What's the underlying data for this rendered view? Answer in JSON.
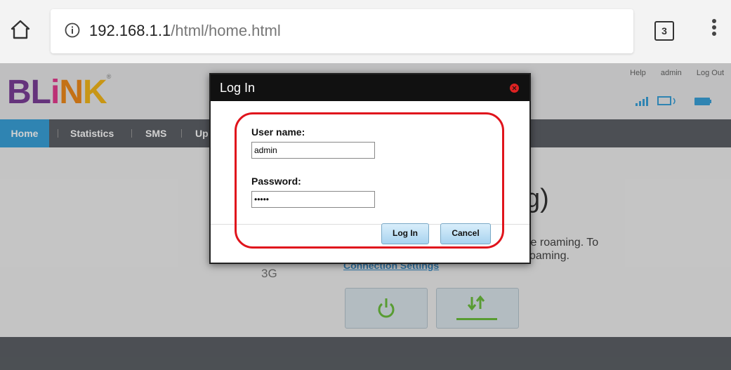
{
  "browser": {
    "url_host": "192.168.1.1",
    "url_path": "/html/home.html",
    "tab_count": "3",
    "icons": {
      "home": "home-icon",
      "info": "info-icon",
      "menu": "overflow-menu-icon"
    }
  },
  "site": {
    "logo": {
      "letters": [
        "B",
        "L",
        "i",
        "N",
        "K"
      ],
      "colors": [
        "#7c3f98",
        "#7c3f98",
        "#e63c8f",
        "#f08a1c",
        "#f5b81a"
      ],
      "reg": "®"
    },
    "top_links": [
      "Help",
      "admin",
      "Log Out"
    ],
    "status_icons": [
      "signal-icon",
      "connection-icon",
      "battery-icon"
    ],
    "accent": "#3aa1d9"
  },
  "nav": {
    "items": [
      "Home",
      "Statistics",
      "SMS",
      "Up"
    ]
  },
  "main": {
    "heading_partial": "g)",
    "roam_text_line1": "le roaming. To",
    "roam_text_line2": "oaming.",
    "network_label": "3G",
    "connection_settings_link": "Connection Settings",
    "buttons": [
      "power-icon",
      "data-transfer-icon"
    ]
  },
  "dialog": {
    "title": "Log In",
    "username_label": "User name:",
    "username_value": "admin",
    "password_label": "Password:",
    "password_value": "•••••",
    "login_button": "Log In",
    "cancel_button": "Cancel",
    "highlight_color": "#e0141c"
  }
}
